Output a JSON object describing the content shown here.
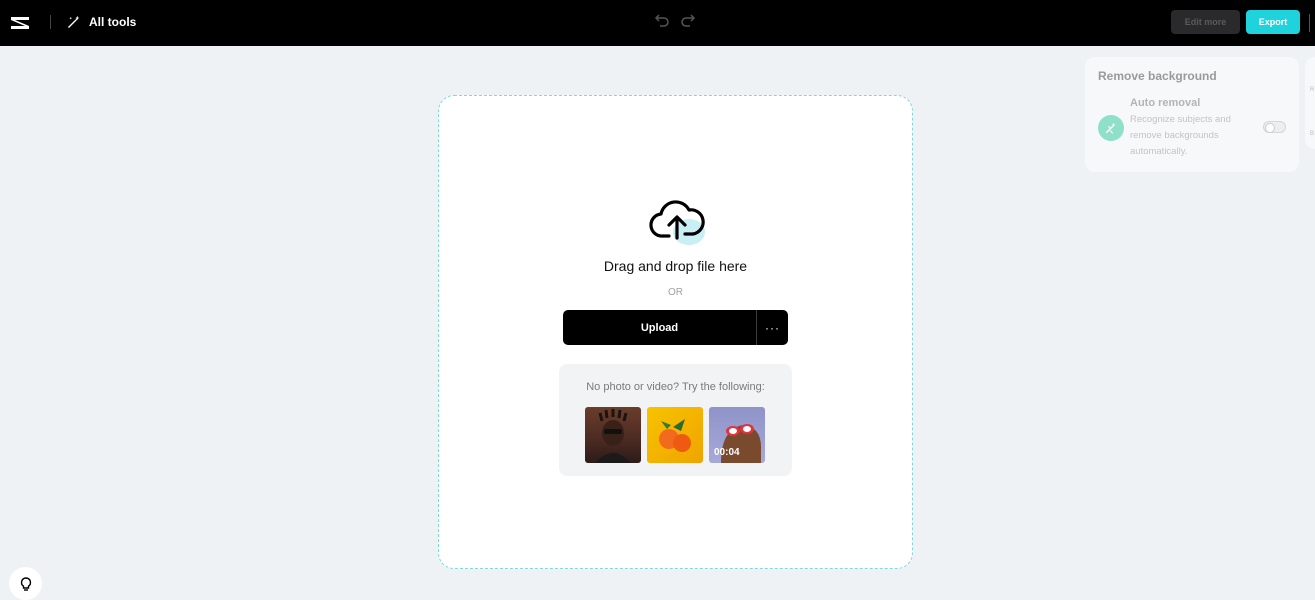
{
  "topbar": {
    "logo_icon": "capcut-logo-icon",
    "all_tools_label": "All tools",
    "all_tools_icon": "magic-wand-icon",
    "undo_icon": "undo-icon",
    "redo_icon": "redo-icon",
    "edit_more_label": "Edit more",
    "export_label": "Export",
    "accent_color": "#1fd3dd"
  },
  "dropzone": {
    "icon": "cloud-upload-icon",
    "title": "Drag and drop file here",
    "or_text": "OR",
    "upload_label": "Upload",
    "more_label": "···"
  },
  "samples": {
    "prompt": "No photo or video? Try the following:",
    "items": [
      {
        "kind": "photo",
        "duration": ""
      },
      {
        "kind": "photo",
        "duration": ""
      },
      {
        "kind": "video",
        "duration": "00:04"
      }
    ]
  },
  "panel": {
    "title": "Remove background",
    "option_title": "Auto removal",
    "option_desc": "Recognize subjects and remove backgrounds automatically.",
    "toggle_on": false,
    "side_labels": [
      "R",
      "B"
    ]
  },
  "hint": {
    "icon": "lightbulb-icon"
  }
}
